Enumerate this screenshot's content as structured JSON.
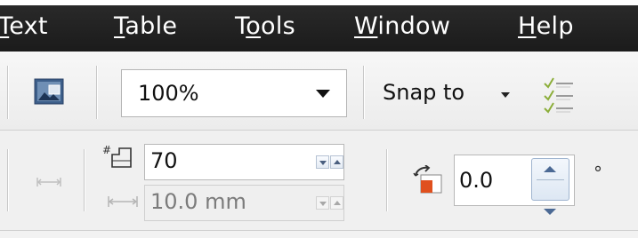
{
  "menu": {
    "items": [
      {
        "label": "Text",
        "accel": "T",
        "rest": "ext"
      },
      {
        "label": "Table",
        "accel": "T",
        "rest": "able"
      },
      {
        "label": "Tools",
        "pre": "T",
        "accel": "o",
        "rest": "ols"
      },
      {
        "label": "Window",
        "accel": "W",
        "rest": "indow"
      },
      {
        "label": "Help",
        "accel": "H",
        "rest": "elp"
      }
    ]
  },
  "toolbar": {
    "zoom_value": "100%",
    "snap_label": "Snap to"
  },
  "property_bar": {
    "copies_value": "70",
    "distance_value": "10.0 mm",
    "rotation_value": "0.0",
    "degree_symbol": "°"
  },
  "icons": {
    "snap_options": "snap-options-icon",
    "image": "image-icon",
    "copies": "copies-icon",
    "distance": "distance-icon",
    "rotation": "rotation-icon"
  },
  "colors": {
    "menubar_bg": "#1f1f1f",
    "rotation_accent": "#e0501e"
  }
}
